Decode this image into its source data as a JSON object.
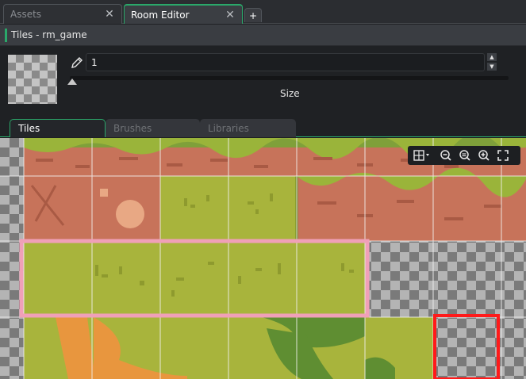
{
  "tabs": {
    "assets_label": "Assets",
    "room_editor_label": "Room Editor",
    "add_label": "+"
  },
  "panel": {
    "title": "Tiles - rm_game"
  },
  "tile_size": {
    "value": "1",
    "label": "Size"
  },
  "subtabs": {
    "tiles": "Tiles",
    "brushes": "Brushes",
    "libraries": "Libraries"
  },
  "zoom_toolbar": {
    "icons": [
      "grid-toggle-icon",
      "zoom-out-icon",
      "zoom-reset-icon",
      "zoom-in-icon",
      "fullscreen-icon"
    ]
  },
  "colors": {
    "accent": "#2aa86a",
    "selection": "#f0a0b8",
    "cursor": "#ff1a1a",
    "grass": "#a8b43c",
    "brick": "#c7735a"
  }
}
